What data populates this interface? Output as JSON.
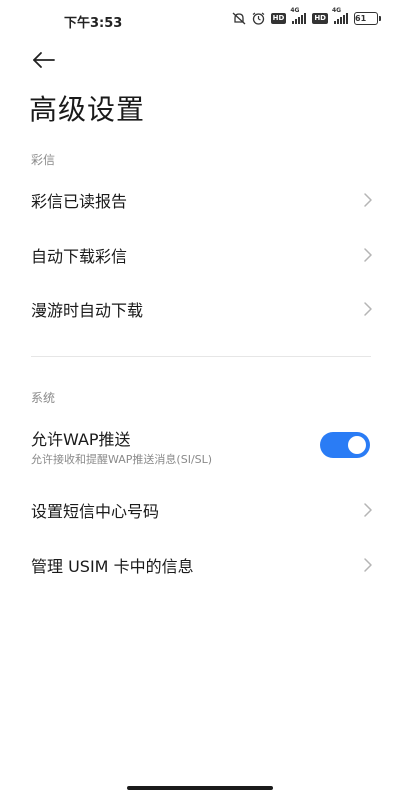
{
  "status_bar": {
    "time": "下午3:53",
    "hd1": "HD",
    "gen1": "4G",
    "hd2": "HD",
    "gen2": "4G",
    "battery": "61",
    "icons": [
      "mute-icon",
      "alarm-icon",
      "hd-icon",
      "signal-icon",
      "hd-icon",
      "signal-icon",
      "battery-icon"
    ]
  },
  "header": {
    "back_icon": "arrow-left-icon",
    "title": "高级设置"
  },
  "mms_section": {
    "label": "彩信",
    "items": [
      {
        "label": "彩信已读报告"
      },
      {
        "label": "自动下载彩信"
      },
      {
        "label": "漫游时自动下载"
      }
    ]
  },
  "system_section": {
    "label": "系统",
    "wap_push": {
      "title": "允许WAP推送",
      "subtitle": "允许接收和提醒WAP推送消息(SI/SL)",
      "enabled": true
    },
    "items": [
      {
        "label": "设置短信中心号码"
      },
      {
        "label": "管理 USIM 卡中的信息"
      }
    ]
  },
  "colors": {
    "accent": "#2a7cf5",
    "secondary_text": "#8a8a8a",
    "chevron": "#b5b5b5"
  }
}
